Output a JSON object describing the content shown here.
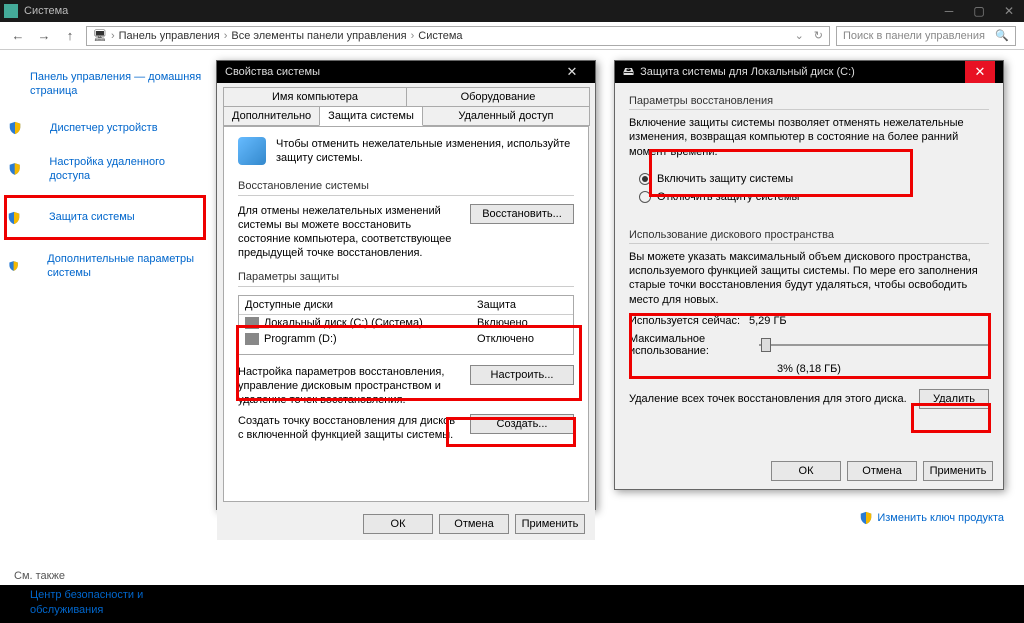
{
  "titlebar": {
    "title": "Система"
  },
  "breadcrumb": [
    "Панель управления",
    "Все элементы панели управления",
    "Система"
  ],
  "search_placeholder": "Поиск в панели управления",
  "sidebar": {
    "home": "Панель управления — домашняя страница",
    "items": [
      "Диспетчер устройств",
      "Настройка удаленного доступа",
      "Защита системы",
      "Дополнительные параметры системы"
    ],
    "seealso": "См. также",
    "seealso_link": "Центр безопасности и обслуживания"
  },
  "dialog1": {
    "title": "Свойства системы",
    "tabs_row1": [
      "Имя компьютера",
      "Оборудование"
    ],
    "tabs_row2": [
      "Дополнительно",
      "Защита системы",
      "Удаленный доступ"
    ],
    "intro": "Чтобы отменить нежелательные изменения, используйте защиту системы.",
    "grp_restore": "Восстановление системы",
    "restore_desc": "Для отмены нежелательных изменений системы вы можете восстановить состояние компьютера, соответствующее предыдущей точке восстановления.",
    "btn_restore": "Восстановить...",
    "grp_protect": "Параметры защиты",
    "col_drives": "Доступные диски",
    "col_status": "Защита",
    "drives": [
      {
        "name": "Локальный диск (C:) (Система)",
        "status": "Включено"
      },
      {
        "name": "Programm (D:)",
        "status": "Отключено"
      }
    ],
    "configure_desc": "Настройка параметров восстановления, управление дисковым пространством и удаление точек восстановления.",
    "btn_configure": "Настроить...",
    "create_desc": "Создать точку восстановления для дисков с включенной функцией защиты системы.",
    "btn_create": "Создать...",
    "btn_ok": "ОК",
    "btn_cancel": "Отмена",
    "btn_apply": "Применить"
  },
  "dialog2": {
    "title": "Защита системы для Локальный диск (C:)",
    "grp_params": "Параметры восстановления",
    "desc": "Включение защиты системы позволяет отменять нежелательные изменения, возвращая компьютер в состояние на более ранний момент времени.",
    "radio_on": "Включить защиту системы",
    "radio_off": "Отключить защиту системы",
    "grp_usage": "Использование дискового пространства",
    "usage_desc": "Вы можете указать максимальный объем дискового пространства, используемого функцией защиты системы. По мере его заполнения старые точки восстановления будут удаляться, чтобы освободить место для новых.",
    "now_label": "Используется сейчас:",
    "now_value": "5,29 ГБ",
    "max_label": "Максимальное использование:",
    "pct": "3% (8,18 ГБ)",
    "del_desc": "Удаление всех точек восстановления для этого диска.",
    "btn_delete": "Удалить",
    "btn_ok": "ОК",
    "btn_cancel": "Отмена",
    "btn_apply": "Применить"
  },
  "footer_link": "Изменить ключ продукта"
}
